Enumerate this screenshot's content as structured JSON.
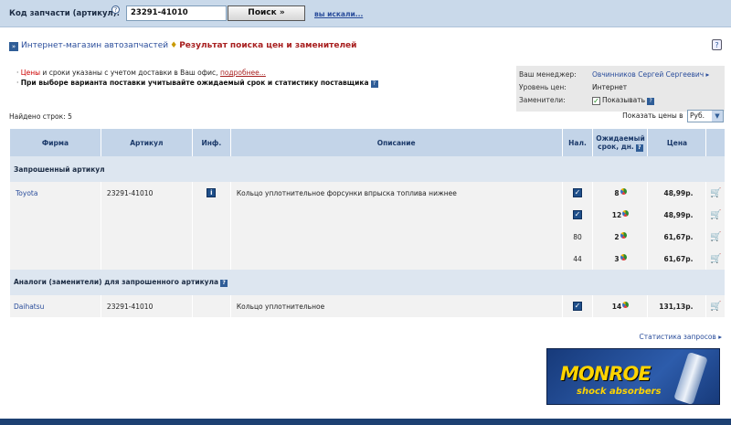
{
  "search": {
    "label": "Код запчасти (артикул):",
    "help": "?",
    "value": "23291-41010",
    "button": "Поиск »",
    "history_link": "вы искали..."
  },
  "header": {
    "breadcrumb": "Интернет-магазин автозапчастей",
    "separator": "♦",
    "title": "Результат поиска цен и заменителей",
    "help": "?"
  },
  "notes": {
    "line1_red": "Цены",
    "line1_text": " и сроки указаны с учетом доставки в Ваш офис, ",
    "line1_link": "подробнее...",
    "line2": "При выборе варианта поставки учитывайте ожидаемый срок и статистику поставщика"
  },
  "manager_box": {
    "manager_label": "Ваш менеджер:",
    "manager_value": "Овчинников Сергей Сергеевич ▸",
    "price_level_label": "Уровень цен:",
    "price_level_value": "Интернет",
    "substitutes_label": "Заменители:",
    "substitutes_value": "Показывать",
    "substitutes_checked": true
  },
  "found": "Найдено строк: 5",
  "currency": {
    "label": "Показать цены в",
    "value": "Руб."
  },
  "table": {
    "headers": {
      "firm": "Фирма",
      "article": "Артикул",
      "info": "Инф.",
      "description": "Описание",
      "stock": "Нал.",
      "expected_1": "Ожидаемый",
      "expected_2": "срок, дн.",
      "price": "Цена"
    },
    "group1": "Запрошенный артикул",
    "group2": "Аналоги (заменители) для запрошенного артикула",
    "requested": {
      "firm": "Toyota",
      "article": "23291-41010",
      "description": "Кольцо уплотнительное форсунки впрыска топлива нижнее",
      "offers": [
        {
          "stock": "",
          "days": "8",
          "price": "48,99р."
        },
        {
          "stock": "",
          "days": "12",
          "price": "48,99р."
        },
        {
          "stock": "80",
          "days": "2",
          "price": "61,67р."
        },
        {
          "stock": "44",
          "days": "3",
          "price": "61,67р."
        }
      ]
    },
    "analog": {
      "firm": "Daihatsu",
      "article": "23291-41010",
      "description": "Кольцо уплотнительное",
      "stock": "",
      "days": "14",
      "price": "131,13р."
    }
  },
  "stats_link": "Статистика запросов ▸",
  "banner": {
    "brand": "MONROE",
    "sub": "shock absorbers"
  }
}
